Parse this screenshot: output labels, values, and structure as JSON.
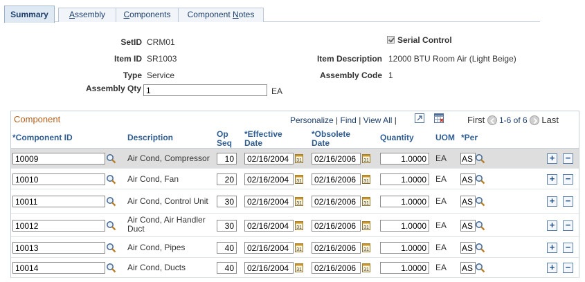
{
  "tabs": [
    {
      "label": "Summary"
    },
    {
      "pre": "",
      "u": "A",
      "post": "ssembly"
    },
    {
      "pre": "",
      "u": "C",
      "post": "omponents"
    },
    {
      "pre": "Component ",
      "u": "N",
      "post": "otes"
    }
  ],
  "header": {
    "setid_label": "SetID",
    "setid_value": "CRM01",
    "item_id_label": "Item ID",
    "item_id_value": "SR1003",
    "type_label": "Type",
    "type_value": "Service",
    "assembly_qty_label": "Assembly Qty",
    "assembly_qty_value": "1",
    "assembly_qty_unit": "EA",
    "serial_control_label": "Serial Control",
    "serial_control_checked": true,
    "item_description_label": "Item Description",
    "item_description_value": "12000 BTU Room Air (Light Beige)",
    "assembly_code_label": "Assembly Code",
    "assembly_code_value": "1"
  },
  "grid": {
    "title": "Component",
    "personalize": "Personalize",
    "find": "Find",
    "view_all": "View All",
    "first": "First",
    "range": "1-6 of 6",
    "last": "Last",
    "columns": {
      "component_id": "*Component ID",
      "description": "Description",
      "op_seq_1": "Op",
      "op_seq_2": "Seq",
      "effective_1": "*Effective",
      "effective_2": "Date",
      "obsolete_1": "*Obsolete",
      "obsolete_2": "Date",
      "quantity": "Quantity",
      "uom": "UOM",
      "per": "*Per"
    },
    "rows": [
      {
        "component_id": "10009",
        "description": "Air Cond, Compressor",
        "op_seq": "10",
        "effective": "02/16/2004",
        "obsolete": "02/16/2006",
        "quantity": "1.0000",
        "uom": "EA",
        "per": "AS"
      },
      {
        "component_id": "10010",
        "description": "Air Cond, Fan",
        "op_seq": "20",
        "effective": "02/16/2004",
        "obsolete": "02/16/2006",
        "quantity": "1.0000",
        "uom": "EA",
        "per": "AS"
      },
      {
        "component_id": "10011",
        "description": "Air Cond, Control Unit",
        "op_seq": "30",
        "effective": "02/16/2004",
        "obsolete": "02/16/2006",
        "quantity": "1.0000",
        "uom": "EA",
        "per": "AS"
      },
      {
        "component_id": "10012",
        "description": "Air Cond, Air Handler Duct",
        "op_seq": "30",
        "effective": "02/16/2004",
        "obsolete": "02/16/2006",
        "quantity": "1.0000",
        "uom": "EA",
        "per": "AS"
      },
      {
        "component_id": "10013",
        "description": "Air Cond, Pipes",
        "op_seq": "40",
        "effective": "02/16/2004",
        "obsolete": "02/16/2006",
        "quantity": "1.0000",
        "uom": "EA",
        "per": "AS"
      },
      {
        "component_id": "10014",
        "description": "Air Cond, Ducts",
        "op_seq": "40",
        "effective": "02/16/2004",
        "obsolete": "02/16/2006",
        "quantity": "1.0000",
        "uom": "EA",
        "per": "AS"
      }
    ],
    "add_glyph": "+",
    "delete_glyph": "−"
  },
  "colors": {
    "tab_active_bg": "#dfe9f3",
    "link": "#1e3f6a",
    "grid_title": "#b35f1b",
    "column_header": "#2f5d92",
    "highlight_row": "#dedede"
  },
  "icons": {
    "lookup": "magnifier-icon",
    "calendar": "calendar-icon",
    "zoom": "zoom-icon",
    "download": "download-spreadsheet-icon",
    "first": "chevron-left-icon",
    "last": "chevron-right-icon"
  }
}
